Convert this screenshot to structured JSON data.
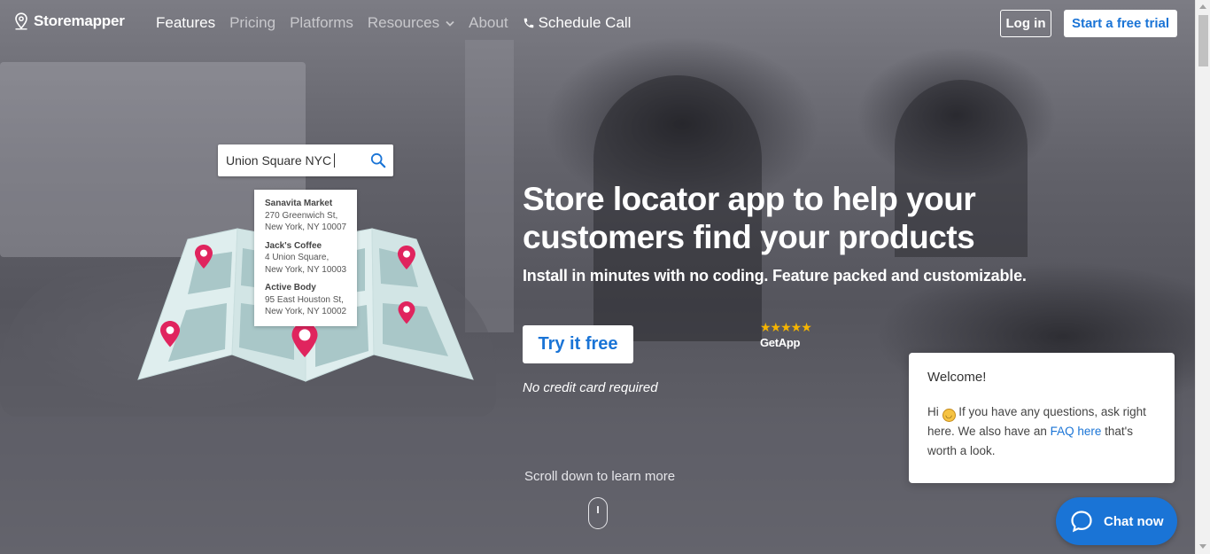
{
  "nav": {
    "logo_text": "Storemapper",
    "links": [
      {
        "label": "Features"
      },
      {
        "label": "Pricing"
      },
      {
        "label": "Platforms"
      },
      {
        "label": "Resources"
      },
      {
        "label": "About"
      }
    ],
    "call_label": "Schedule Call",
    "login_label": "Log in",
    "trial_label": "Start a free trial"
  },
  "illustration": {
    "search_value": "Union Square NYC",
    "results": [
      {
        "name": "Sanavita Market",
        "line1": "270 Greenwich St,",
        "line2": "New York, NY 10007"
      },
      {
        "name": "Jack's Coffee",
        "line1": "4 Union Square,",
        "line2": "New York, NY 10003"
      },
      {
        "name": "Active Body",
        "line1": "95 East Houston St,",
        "line2": "New York, NY 10002"
      }
    ]
  },
  "hero": {
    "headline": "Store locator app to help your customers find your products",
    "subhead": "Install in minutes with no coding. Feature packed and customizable.",
    "cta_label": "Try it free",
    "no_cc": "No credit card required",
    "rating_stars": "★★★★★",
    "rating_source": "GetApp",
    "scroll_hint": "Scroll down to learn more"
  },
  "chat": {
    "title": "Welcome!",
    "greeting": "Hi",
    "body_part1": "If you have any questions, ask right here. We also have an",
    "faq_link": "FAQ here",
    "body_part2": "that's worth a look.",
    "button_label": "Chat now"
  },
  "colors": {
    "accent": "#1a74d6",
    "pin": "#e0245e",
    "map_fill": "#dfeeee",
    "map_road": "#a9c7c8"
  }
}
